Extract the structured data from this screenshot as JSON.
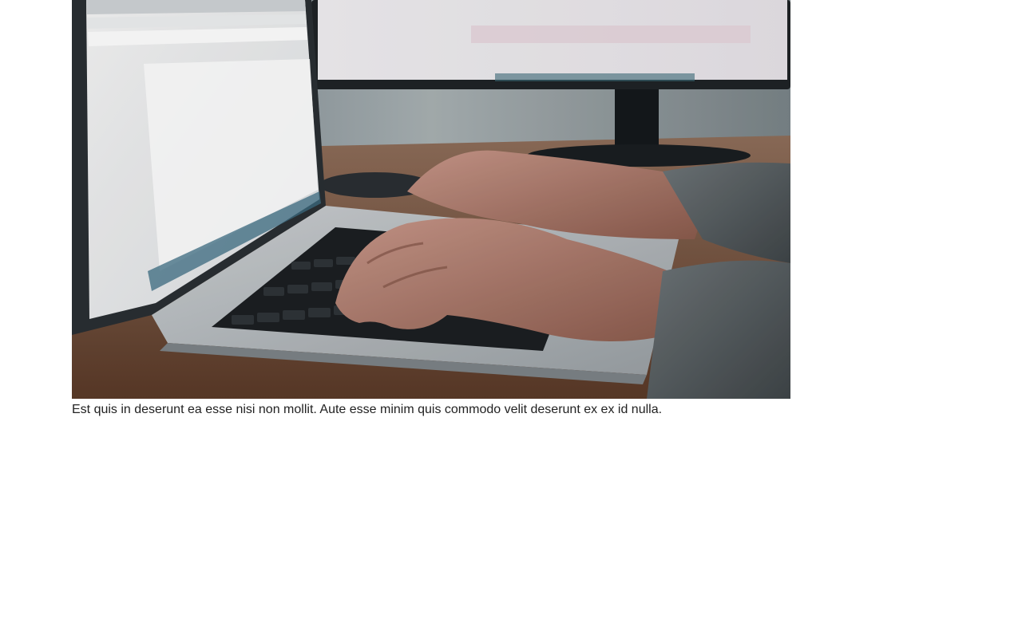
{
  "main": {
    "photo": {
      "subject": "laptop-typing-photo"
    },
    "caption": "Est quis in deserunt ea esse nisi non mollit. Aute esse minim quis commodo velit deserunt ex ex id nulla."
  }
}
